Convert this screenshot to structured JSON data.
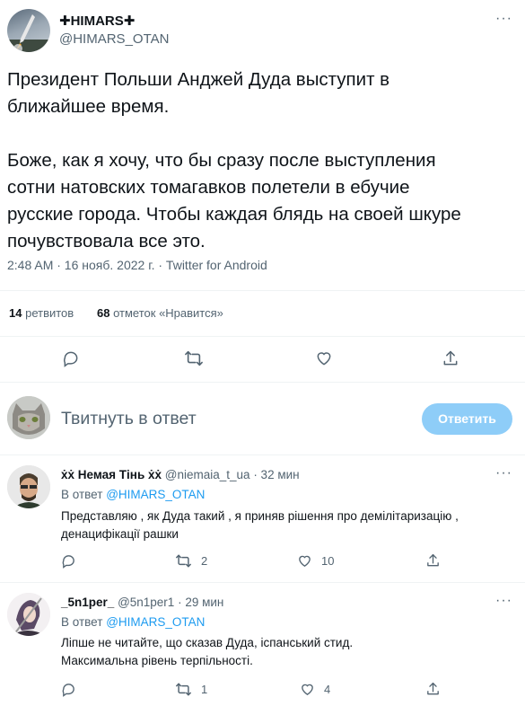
{
  "main_tweet": {
    "display_name": "✚HIMARS✚",
    "handle": "@HIMARS_OTAN",
    "text_lines": [
      "Президент Польши Анджей Дуда выступит в",
      "ближайшее время.",
      "",
      "Боже, как я хочу, что бы сразу после выступления",
      "сотни натовских томагавков полетели в ебучие",
      "русские города. Чтобы каждая блядь на своей шкуре",
      "почувствовала все это."
    ],
    "meta": "2:48 AM · 16 нояб. 2022 г. · Twitter for Android",
    "retweets_count": "14",
    "retweets_label": "ретвитов",
    "likes_count": "68",
    "likes_label": "отметок «Нравится»"
  },
  "compose": {
    "placeholder": "Твитнуть в ответ",
    "button": "Ответить"
  },
  "replies": [
    {
      "display_name": "ẋẋ Немая Тінь ẋẋ",
      "handle": "@niemaia_t_ua",
      "time": "· 32 мин",
      "reply_to_prefix": "В ответ",
      "reply_to": "@HIMARS_OTAN",
      "text_lines": [
        "Представляю , як Дуда такий , я приняв рішення про демілітаризацію ,",
        "денацифікації рашки"
      ],
      "retweets": "2",
      "likes": "10"
    },
    {
      "display_name": "_5n1per_",
      "handle": "@5n1per1",
      "time": "· 29 мин",
      "reply_to_prefix": "В ответ",
      "reply_to": "@HIMARS_OTAN",
      "text_lines": [
        "Ліпше не читайте, що сказав Дуда, іспанський стид.",
        "Максимальна рівень терпільності."
      ],
      "retweets": "1",
      "likes": "4"
    }
  ],
  "colors": {
    "accent": "#1d9bf0",
    "button_disabled": "#8ecdf8",
    "muted_text": "#536471",
    "divider": "#eff3f4"
  }
}
